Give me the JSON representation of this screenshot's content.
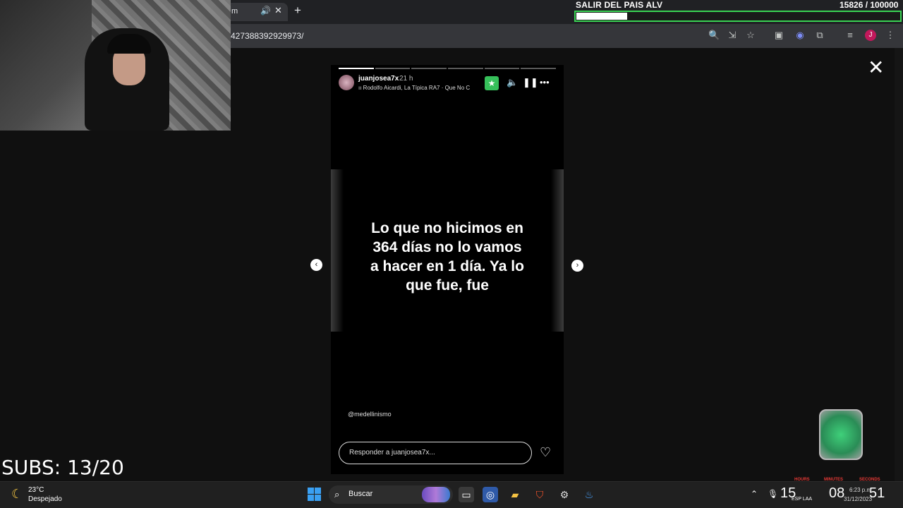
{
  "browser": {
    "tab_title": "m",
    "url": "427388392929973/",
    "avatar_letter": "J"
  },
  "goal": {
    "label": "SALIR DEL PAIS ALV",
    "count": "15826  / 100000",
    "progress": 0.158,
    "color": "#39d353"
  },
  "story": {
    "username": "juanjosea7x",
    "time": "21 h",
    "music": "Rodolfo Aicardi, La Típica RA7 · Que No C",
    "text": "Lo que no hicimos en 364 días no lo vamos a hacer en 1 día. Ya lo que fue, fue",
    "mention": "@medellinismo",
    "reply_placeholder": "Responder a juanjosea7x...",
    "segments": 6,
    "active_segment": 1
  },
  "overlay": {
    "subs": "SUBS: 13/20"
  },
  "taskbar": {
    "temp": "23°C",
    "weather": "Despejado",
    "search": "Buscar",
    "clock_hours": "15",
    "clock_minutes": "08",
    "clock_seconds": "51",
    "timer_labels": [
      "HOURS",
      "MINUTES",
      "SECONDS"
    ],
    "lang": "ESP LAA",
    "time": "6:23 p.m.",
    "date": "31/12/2023"
  }
}
